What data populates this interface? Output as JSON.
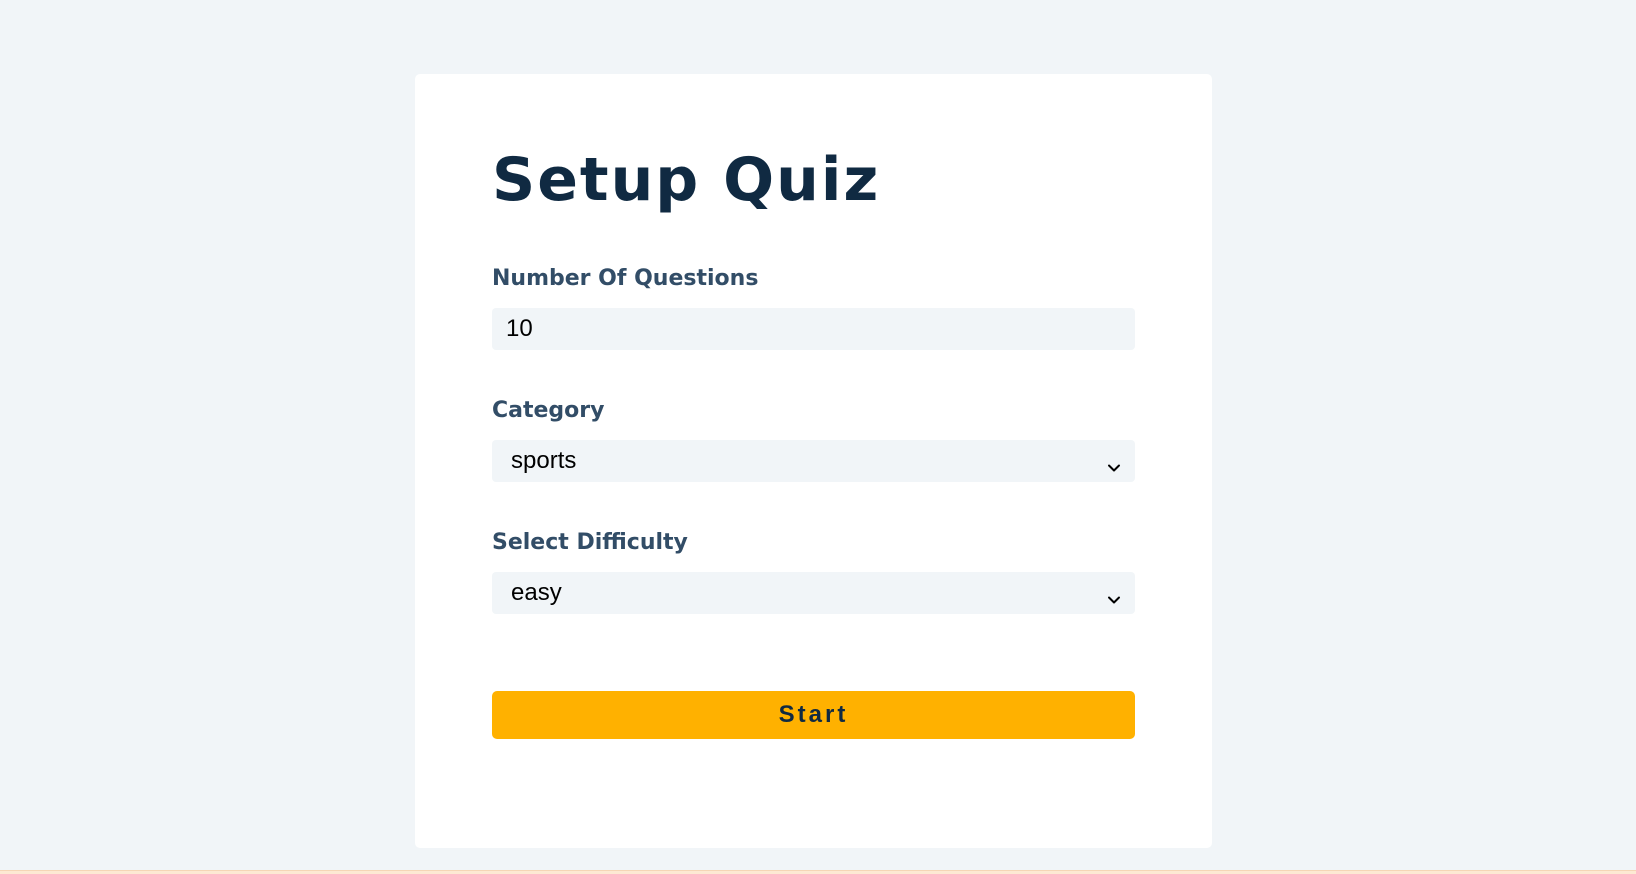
{
  "page": {
    "title": "Setup Quiz"
  },
  "form": {
    "amount": {
      "label": "Number Of Questions",
      "value": "10"
    },
    "category": {
      "label": "Category",
      "value": "sports"
    },
    "difficulty": {
      "label": "Select Difficulty",
      "value": "easy"
    },
    "submit_label": "Start"
  },
  "colors": {
    "background": "#f1f5f8",
    "card": "#ffffff",
    "title": "#102a42",
    "label": "#324d67",
    "button": "#ffb100"
  },
  "icons": {
    "select_arrow": "chevron-down-icon"
  }
}
